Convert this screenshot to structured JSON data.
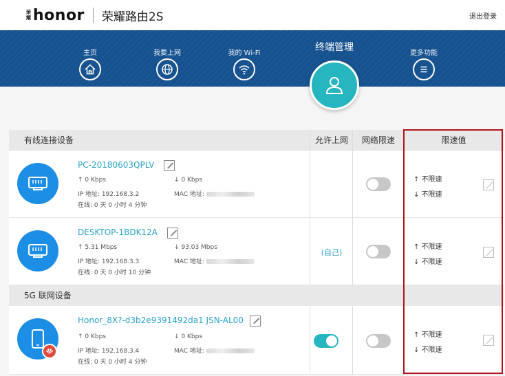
{
  "header": {
    "brand_cn": [
      "荣",
      "耀"
    ],
    "brand_en": "honor",
    "product": "荣耀路由2S",
    "logout": "退出登录"
  },
  "nav": {
    "items": [
      {
        "label": "主页",
        "icon": "home-icon"
      },
      {
        "label": "我要上网",
        "icon": "globe-icon"
      },
      {
        "label": "我的 Wi-Fi",
        "icon": "wifi-icon"
      },
      {
        "label": "终端管理",
        "icon": "user-icon",
        "active": true
      },
      {
        "label": "更多功能",
        "icon": "menu-icon"
      }
    ]
  },
  "table": {
    "headers": {
      "wired": "有线连接设备",
      "allow": "允许上网",
      "limit_toggle": "网络限速",
      "limit_value": "限速值"
    },
    "section_5g": "5G 联网设备",
    "devices": [
      {
        "name": "PC-20180603QPLV",
        "up": "0 Kbps",
        "down": "0 Kbps",
        "ip": "IP 地址: 192.168.3.2",
        "mac": "MAC 地址:",
        "online": "在线: 0 天 0 小时 4 分钟",
        "allow": "",
        "speed_limit_on": false,
        "limit_up": "不限速",
        "limit_down": "不限速",
        "icon": "ethernet-icon"
      },
      {
        "name": "DESKTOP-1BDK12A",
        "up": "5.31 Mbps",
        "down": "93.03 Mbps",
        "ip": "IP 地址: 192.168.3.3",
        "mac": "MAC 地址:",
        "online": "在线: 0 天 0 小时 10 分钟",
        "allow": "(自己)",
        "speed_limit_on": false,
        "limit_up": "不限速",
        "limit_down": "不限速",
        "icon": "ethernet-icon"
      },
      {
        "name": "Honor_8X?-d3b2e9391492da1 JSN-AL00",
        "up": "0 Kbps",
        "down": "0 Kbps",
        "ip": "IP 地址: 192.168.3.4",
        "mac": "MAC 地址:",
        "online": "在线: 0 天 0 小时 4 分钟",
        "allow_on": true,
        "speed_limit_on": false,
        "limit_up": "不限速",
        "limit_down": "不限速",
        "icon": "phone-icon"
      }
    ]
  },
  "colors": {
    "nav_bg": "#16528f",
    "accent": "#26b6c0",
    "device_icon": "#1d8ee6",
    "link": "#2aa3c7",
    "highlight_box": "#b0121a"
  }
}
